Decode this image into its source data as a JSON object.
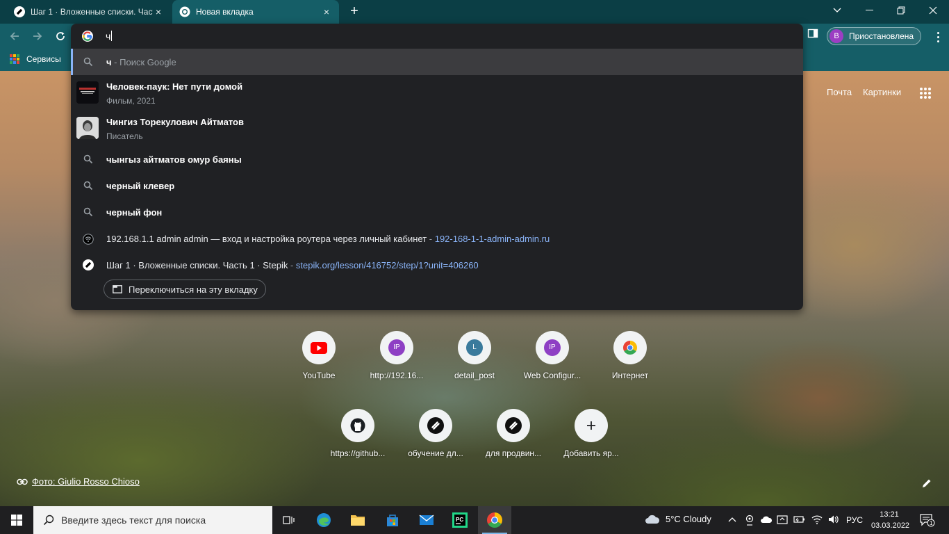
{
  "tabs": [
    {
      "title": "Шаг 1 · Вложенные списки. Част",
      "close": "×",
      "favicon": "stepik-icon"
    },
    {
      "title": "Новая вкладка",
      "close": "×",
      "favicon": "chrome-icon"
    }
  ],
  "new_tab_symbol": "+",
  "omnibox": {
    "query": "ч",
    "first_suggestion": {
      "bold": "ч",
      "rest": " - Поиск Google"
    },
    "entities": [
      {
        "title": "Человек-паук: Нет пути домой",
        "subtitle": "Фильм, 2021"
      },
      {
        "title": "Чингиз Торекулович Айтматов",
        "subtitle": "Писатель"
      }
    ],
    "searches": [
      {
        "bold": "чынгыз айтматов омур баяны"
      },
      {
        "bold": "черный клевер"
      },
      {
        "bold": "черный фон"
      }
    ],
    "pages": [
      {
        "title": "192.168.1.1 admin admin — вход и настройка роутера через личный кабинет",
        "sep": " - ",
        "url": "192-168-1-1-admin-admin.ru"
      },
      {
        "title": "Шаг 1 · Вложенные списки. Часть 1 · Stepik",
        "sep": " - ",
        "url": "stepik.org/lesson/416752/step/1?unit=406260"
      }
    ],
    "switch_tab_label": "Переключиться на эту вкладку"
  },
  "profile": {
    "initial": "В",
    "status": "Приостановлена"
  },
  "bookmarks": {
    "apps_label": "Сервисы"
  },
  "google_links": {
    "mail": "Почта",
    "images": "Картинки"
  },
  "shortcuts": [
    {
      "label": "YouTube",
      "icon": "youtube-icon"
    },
    {
      "label": "http://192.16...",
      "icon": "IP",
      "color": "#8e3fc4"
    },
    {
      "label": "detail_post",
      "icon": "L",
      "color": "#3a7a9c"
    },
    {
      "label": "Web Configur...",
      "icon": "IP",
      "color": "#8e3fc4"
    },
    {
      "label": "Интернет",
      "icon": "chrome-icon"
    },
    {
      "label": "https://github...",
      "icon": "github-icon"
    },
    {
      "label": "обучение дл...",
      "icon": "stepik-icon"
    },
    {
      "label": "для продвин...",
      "icon": "stepik-icon"
    },
    {
      "label": "Добавить яр...",
      "icon": "plus-icon"
    }
  ],
  "photo_credit": "Фото: Giulio Rosso Chioso",
  "taskbar": {
    "search_placeholder": "Введите здесь текст для поиска",
    "weather": "5°C  Cloudy",
    "lang": "РУС",
    "time": "13:21",
    "date": "03.03.2022",
    "notifications": "1"
  },
  "colors": {
    "tab_strip": "#0b3e45",
    "toolbar": "#155e67",
    "omnibox_bg": "#202124",
    "link": "#8ab4f8"
  }
}
